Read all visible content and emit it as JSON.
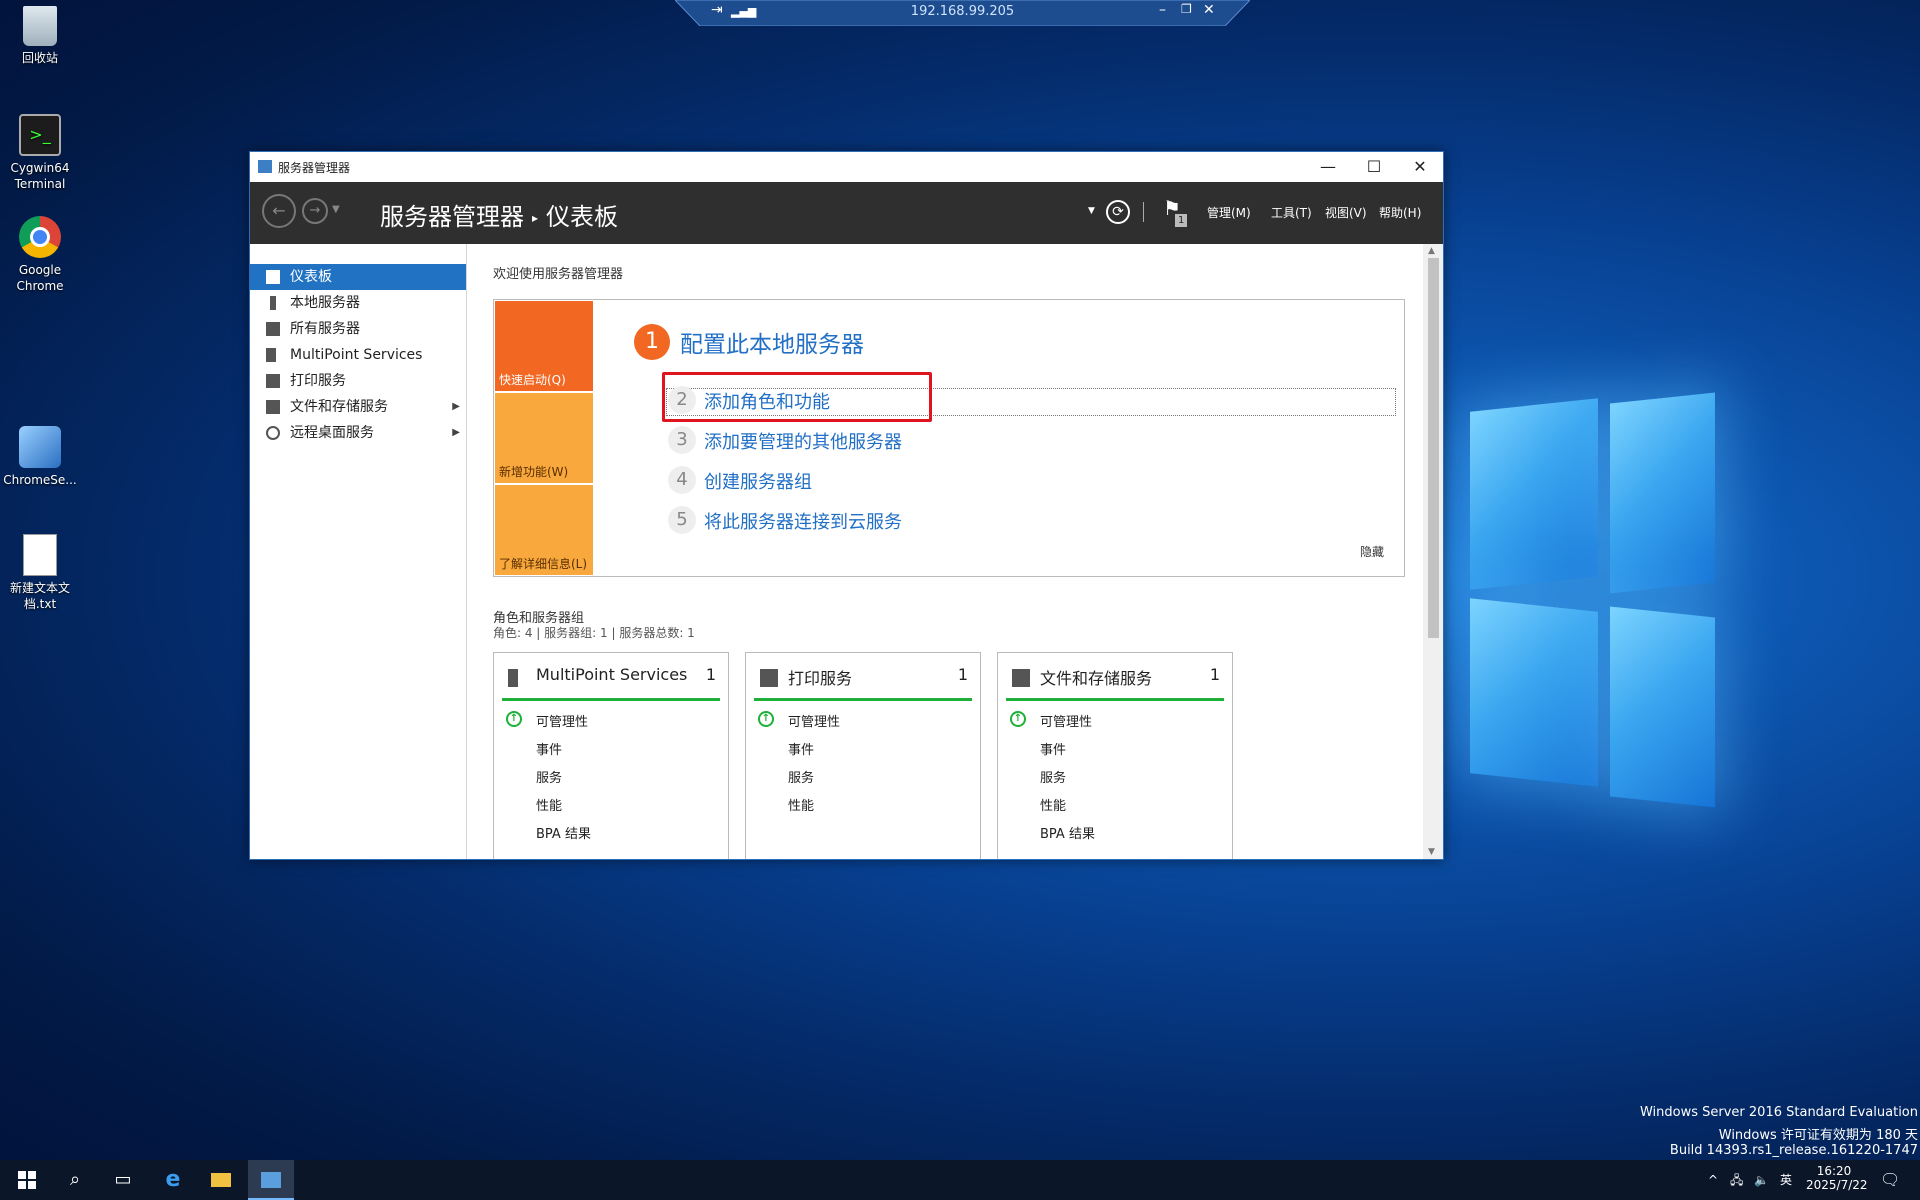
{
  "rdp": {
    "host": "192.168.99.205"
  },
  "desktop_icons": [
    {
      "label": "回收站"
    },
    {
      "label": "Cygwin64 Terminal"
    },
    {
      "label": "Google Chrome"
    },
    {
      "label": "ChromeSe..."
    },
    {
      "label": "新建文本文档.txt"
    }
  ],
  "window": {
    "title": "服务器管理器",
    "breadcrumb_root": "服务器管理器",
    "breadcrumb_current": "仪表板",
    "notif_count": "1",
    "menu": [
      "管理(M)",
      "工具(T)",
      "视图(V)",
      "帮助(H)"
    ]
  },
  "sidebar": {
    "items": [
      {
        "label": "仪表板",
        "icon": "dashboard-icon"
      },
      {
        "label": "本地服务器",
        "icon": "server-icon"
      },
      {
        "label": "所有服务器",
        "icon": "servers-icon"
      },
      {
        "label": "MultiPoint Services",
        "icon": "multipoint-icon"
      },
      {
        "label": "打印服务",
        "icon": "printer-icon"
      },
      {
        "label": "文件和存储服务",
        "icon": "folder-icon"
      },
      {
        "label": "远程桌面服务",
        "icon": "remote-desktop-icon"
      }
    ]
  },
  "main": {
    "welcome": "欢迎使用服务器管理器",
    "tiles": [
      "快速启动(Q)",
      "新增功能(W)",
      "了解详细信息(L)"
    ],
    "step1": {
      "num": "1",
      "label": "配置此本地服务器"
    },
    "steps": [
      {
        "num": "2",
        "label": "添加角色和功能"
      },
      {
        "num": "3",
        "label": "添加要管理的其他服务器"
      },
      {
        "num": "4",
        "label": "创建服务器组"
      },
      {
        "num": "5",
        "label": "将此服务器连接到云服务"
      }
    ],
    "hide": "隐藏",
    "roles_title": "角色和服务器组",
    "roles_sub": "角色: 4 | 服务器组: 1 | 服务器总数: 1",
    "cards": [
      {
        "title": "MultiPoint Services",
        "count": "1",
        "items": [
          "可管理性",
          "事件",
          "服务",
          "性能",
          "BPA 结果"
        ]
      },
      {
        "title": "打印服务",
        "count": "1",
        "items": [
          "可管理性",
          "事件",
          "服务",
          "性能"
        ]
      },
      {
        "title": "文件和存储服务",
        "count": "1",
        "items": [
          "可管理性",
          "事件",
          "服务",
          "性能",
          "BPA 结果"
        ]
      }
    ]
  },
  "watermark": {
    "line1": "Windows Server 2016 Standard Evaluation",
    "line2": "Windows 许可证有效期为 180 天",
    "line3": "Build 14393.rs1_release.161220-1747"
  },
  "taskbar": {
    "ime": "英",
    "time": "16:20",
    "date": "2025/7/22"
  }
}
